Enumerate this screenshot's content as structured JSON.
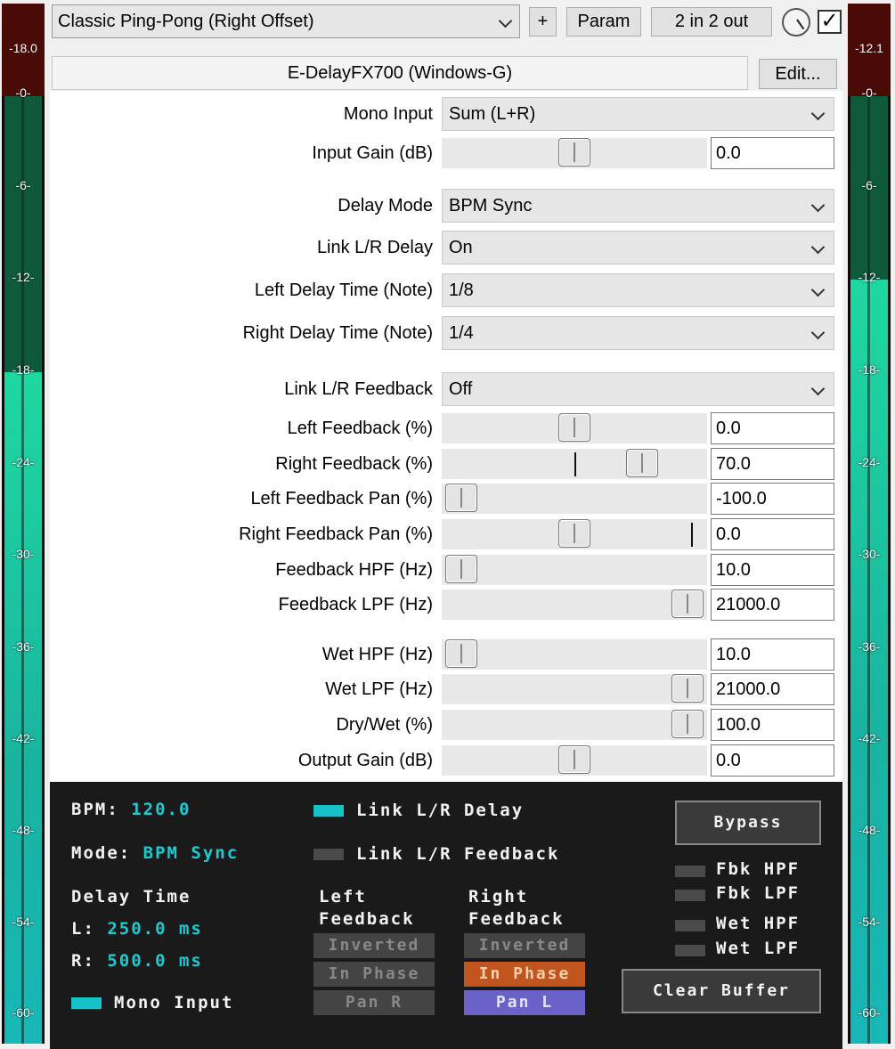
{
  "colors": {
    "meter_clip": "#4a0a06",
    "meter_green_dark": "#0e5a3a",
    "meter_green_bright": "#1fd8a0",
    "status_bg": "#1a1a1a",
    "status_accent": "#1ccbd1",
    "btn_orange": "#c2541f",
    "btn_purple": "#6a62c7"
  },
  "meters": {
    "left": {
      "peak": "-18.0",
      "level_db": -18.0
    },
    "right": {
      "peak": "-12.1",
      "level_db": -12.1
    },
    "ticks": [
      "-0-",
      "-6-",
      "-12-",
      "-18-",
      "-24-",
      "-30-",
      "-36-",
      "-42-",
      "-48-",
      "-54-",
      "-60-"
    ]
  },
  "toolbar": {
    "preset": "Classic Ping-Pong (Right Offset)",
    "add_label": "+",
    "param_label": "Param",
    "io_label": "2 in 2 out",
    "enabled_check": "✓",
    "plugin_name": "E-DelayFX700 (Windows-G)",
    "edit_label": "Edit..."
  },
  "params": {
    "mono_input": {
      "label": "Mono Input",
      "value": "Sum (L+R)"
    },
    "input_gain": {
      "label": "Input Gain (dB)",
      "value": "0.0",
      "pos": 0.5
    },
    "delay_mode": {
      "label": "Delay Mode",
      "value": "BPM Sync"
    },
    "link_delay": {
      "label": "Link L/R Delay",
      "value": "On"
    },
    "left_delay_note": {
      "label": "Left Delay Time (Note)",
      "value": "1/8"
    },
    "right_delay_note": {
      "label": "Right Delay Time (Note)",
      "value": "1/4"
    },
    "link_feedback": {
      "label": "Link L/R Feedback",
      "value": "Off"
    },
    "left_feedback": {
      "label": "Left Feedback (%)",
      "value": "0.0",
      "pos": 0.5
    },
    "right_feedback": {
      "label": "Right Feedback (%)",
      "value": "70.0",
      "pos": 0.8,
      "marker": 0.5
    },
    "left_fb_pan": {
      "label": "Left Feedback Pan (%)",
      "value": "-100.0",
      "pos": 0.0
    },
    "right_fb_pan": {
      "label": "Right Feedback Pan (%)",
      "value": "0.0",
      "pos": 0.5,
      "marker": 0.94
    },
    "fb_hpf": {
      "label": "Feedback HPF (Hz)",
      "value": "10.0",
      "pos": 0.0
    },
    "fb_lpf": {
      "label": "Feedback LPF (Hz)",
      "value": "21000.0",
      "pos": 1.0
    },
    "wet_hpf": {
      "label": "Wet HPF (Hz)",
      "value": "10.0",
      "pos": 0.0
    },
    "wet_lpf": {
      "label": "Wet LPF (Hz)",
      "value": "21000.0",
      "pos": 1.0
    },
    "dry_wet": {
      "label": "Dry/Wet (%)",
      "value": "100.0",
      "pos": 1.0
    },
    "output_gain": {
      "label": "Output Gain (dB)",
      "value": "0.0",
      "pos": 0.5
    }
  },
  "status": {
    "bpm_label": "BPM:",
    "bpm_value": "120.0",
    "mode_label": "Mode:",
    "mode_value": "BPM Sync",
    "delay_time_label": "Delay Time",
    "l_label": "L:",
    "l_value": "250.0 ms",
    "r_label": "R:",
    "r_value": "500.0 ms",
    "mono_input": "Mono Input",
    "link_delay": "Link L/R Delay",
    "link_feedback": "Link L/R Feedback",
    "left_fb_title_1": "Left",
    "left_fb_title_2": "Feedback",
    "right_fb_title_1": "Right",
    "right_fb_title_2": "Feedback",
    "left_inverted": "Inverted",
    "left_phase": "In Phase",
    "left_pan": "Pan R",
    "right_inverted": "Inverted",
    "right_phase": "In Phase",
    "right_pan": "Pan L",
    "bypass": "Bypass",
    "fbk_hpf": "Fbk HPF",
    "fbk_lpf": "Fbk LPF",
    "wet_hpf": "Wet HPF",
    "wet_lpf": "Wet LPF",
    "clear_buffer": "Clear Buffer"
  }
}
